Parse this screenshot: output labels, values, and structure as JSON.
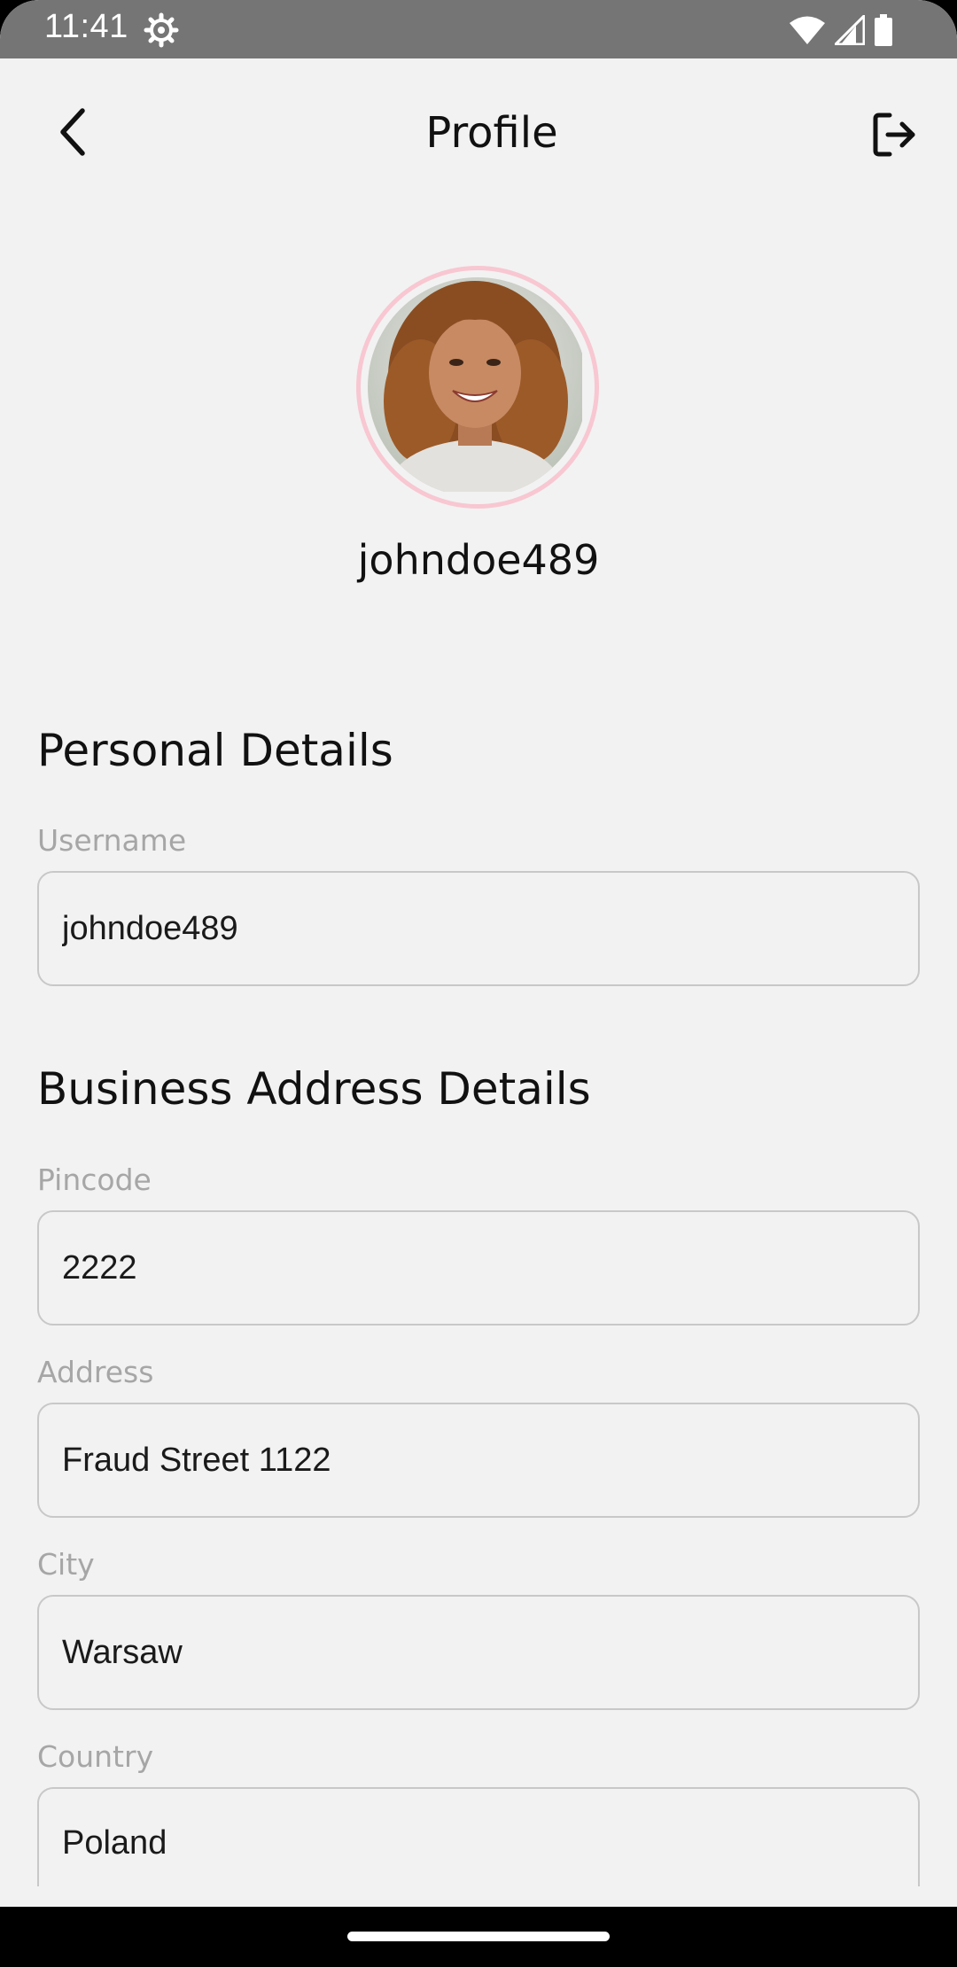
{
  "status_bar": {
    "time": "11:41",
    "icons": [
      "gear-icon",
      "wifi-icon",
      "signal-icon",
      "battery-icon"
    ]
  },
  "header": {
    "title": "Profile",
    "back_icon": "chevron-left-icon",
    "logout_icon": "logout-icon"
  },
  "profile": {
    "username": "johndoe489",
    "avatar_ring_color": "#f8c7d1"
  },
  "personal_details": {
    "title": "Personal Details",
    "username_label": "Username",
    "username_value": "johndoe489"
  },
  "business_address": {
    "title": "Business Address Details",
    "pincode_label": "Pincode",
    "pincode_value": "2222",
    "address_label": "Address",
    "address_value": "Fraud Street 1122",
    "city_label": "City",
    "city_value": "Warsaw",
    "country_label": "Country",
    "country_value": "Poland"
  }
}
